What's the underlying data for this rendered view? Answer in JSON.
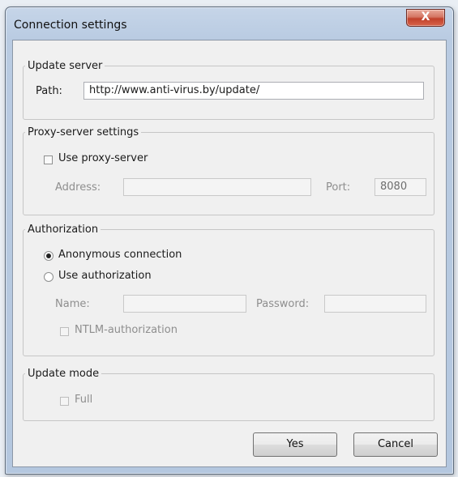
{
  "window": {
    "title": "Connection settings",
    "close_label": "X"
  },
  "update_server": {
    "legend": "Update server",
    "path_label": "Path:",
    "path_value": "http://www.anti-virus.by/update/"
  },
  "proxy": {
    "legend": "Proxy-server settings",
    "use_proxy_label": "Use proxy-server",
    "use_proxy_checked": false,
    "address_label": "Address:",
    "address_value": "",
    "port_label": "Port:",
    "port_value": "8080"
  },
  "authorization": {
    "legend": "Authorization",
    "anonymous_label": "Anonymous connection",
    "anonymous_selected": true,
    "use_auth_label": "Use authorization",
    "use_auth_selected": false,
    "name_label": "Name:",
    "name_value": "",
    "password_label": "Password:",
    "password_value": "",
    "ntlm_label": "NTLM-authorization",
    "ntlm_checked": false
  },
  "update_mode": {
    "legend": "Update mode",
    "full_label": "Full",
    "full_checked": false
  },
  "buttons": {
    "yes": "Yes",
    "cancel": "Cancel"
  }
}
